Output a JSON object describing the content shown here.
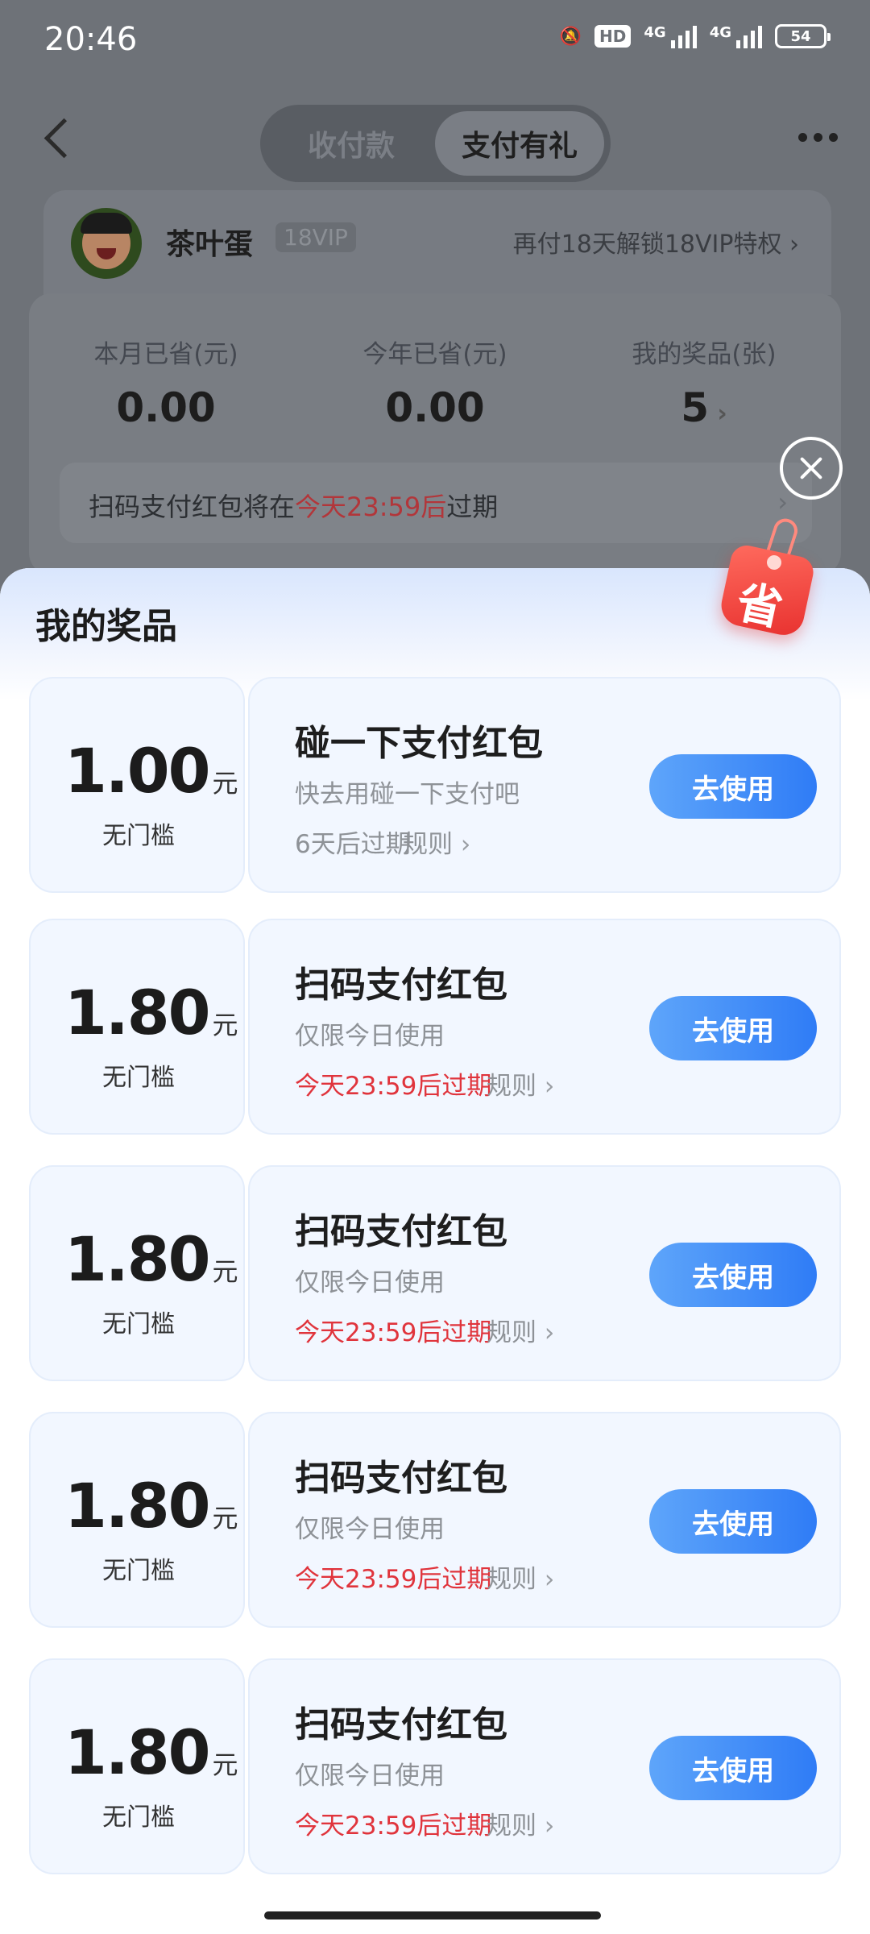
{
  "status_bar": {
    "time": "20:46",
    "hd": "HD",
    "net1": "4G",
    "net2": "4G",
    "battery": "54"
  },
  "header": {
    "tabs": [
      {
        "label": "收付款",
        "active": false
      },
      {
        "label": "支付有礼",
        "active": true
      }
    ]
  },
  "vip": {
    "name": "茶叶蛋",
    "level": "18VIP",
    "hint": "再付18天解锁18VIP特权 ›"
  },
  "stats": [
    {
      "label": "本月已省(元)",
      "value": "0.00"
    },
    {
      "label": "今年已省(元)",
      "value": "0.00"
    },
    {
      "label": "我的奖品(张)",
      "value": "5"
    }
  ],
  "notice": {
    "prefix": "扫码支付红包将在",
    "highlight": "今天23:59后",
    "suffix": "过期",
    "arrow": "›"
  },
  "sheet": {
    "title": "我的奖品",
    "tag": "省"
  },
  "coupons": [
    {
      "amount": "1.00",
      "unit": "元",
      "threshold": "无门槛",
      "title": "碰一下支付红包",
      "subtitle": "快去用碰一下支付吧",
      "expire": "6天后过期",
      "expire_red": false,
      "rule": "规则",
      "button": "去使用"
    },
    {
      "amount": "1.80",
      "unit": "元",
      "threshold": "无门槛",
      "title": "扫码支付红包",
      "subtitle": "仅限今日使用",
      "expire": "今天23:59后过期",
      "expire_red": true,
      "rule": "规则",
      "button": "去使用"
    },
    {
      "amount": "1.80",
      "unit": "元",
      "threshold": "无门槛",
      "title": "扫码支付红包",
      "subtitle": "仅限今日使用",
      "expire": "今天23:59后过期",
      "expire_red": true,
      "rule": "规则",
      "button": "去使用"
    },
    {
      "amount": "1.80",
      "unit": "元",
      "threshold": "无门槛",
      "title": "扫码支付红包",
      "subtitle": "仅限今日使用",
      "expire": "今天23:59后过期",
      "expire_red": true,
      "rule": "规则",
      "button": "去使用"
    },
    {
      "amount": "1.80",
      "unit": "元",
      "threshold": "无门槛",
      "title": "扫码支付红包",
      "subtitle": "仅限今日使用",
      "expire": "今天23:59后过期",
      "expire_red": true,
      "rule": "规则",
      "button": "去使用"
    }
  ]
}
